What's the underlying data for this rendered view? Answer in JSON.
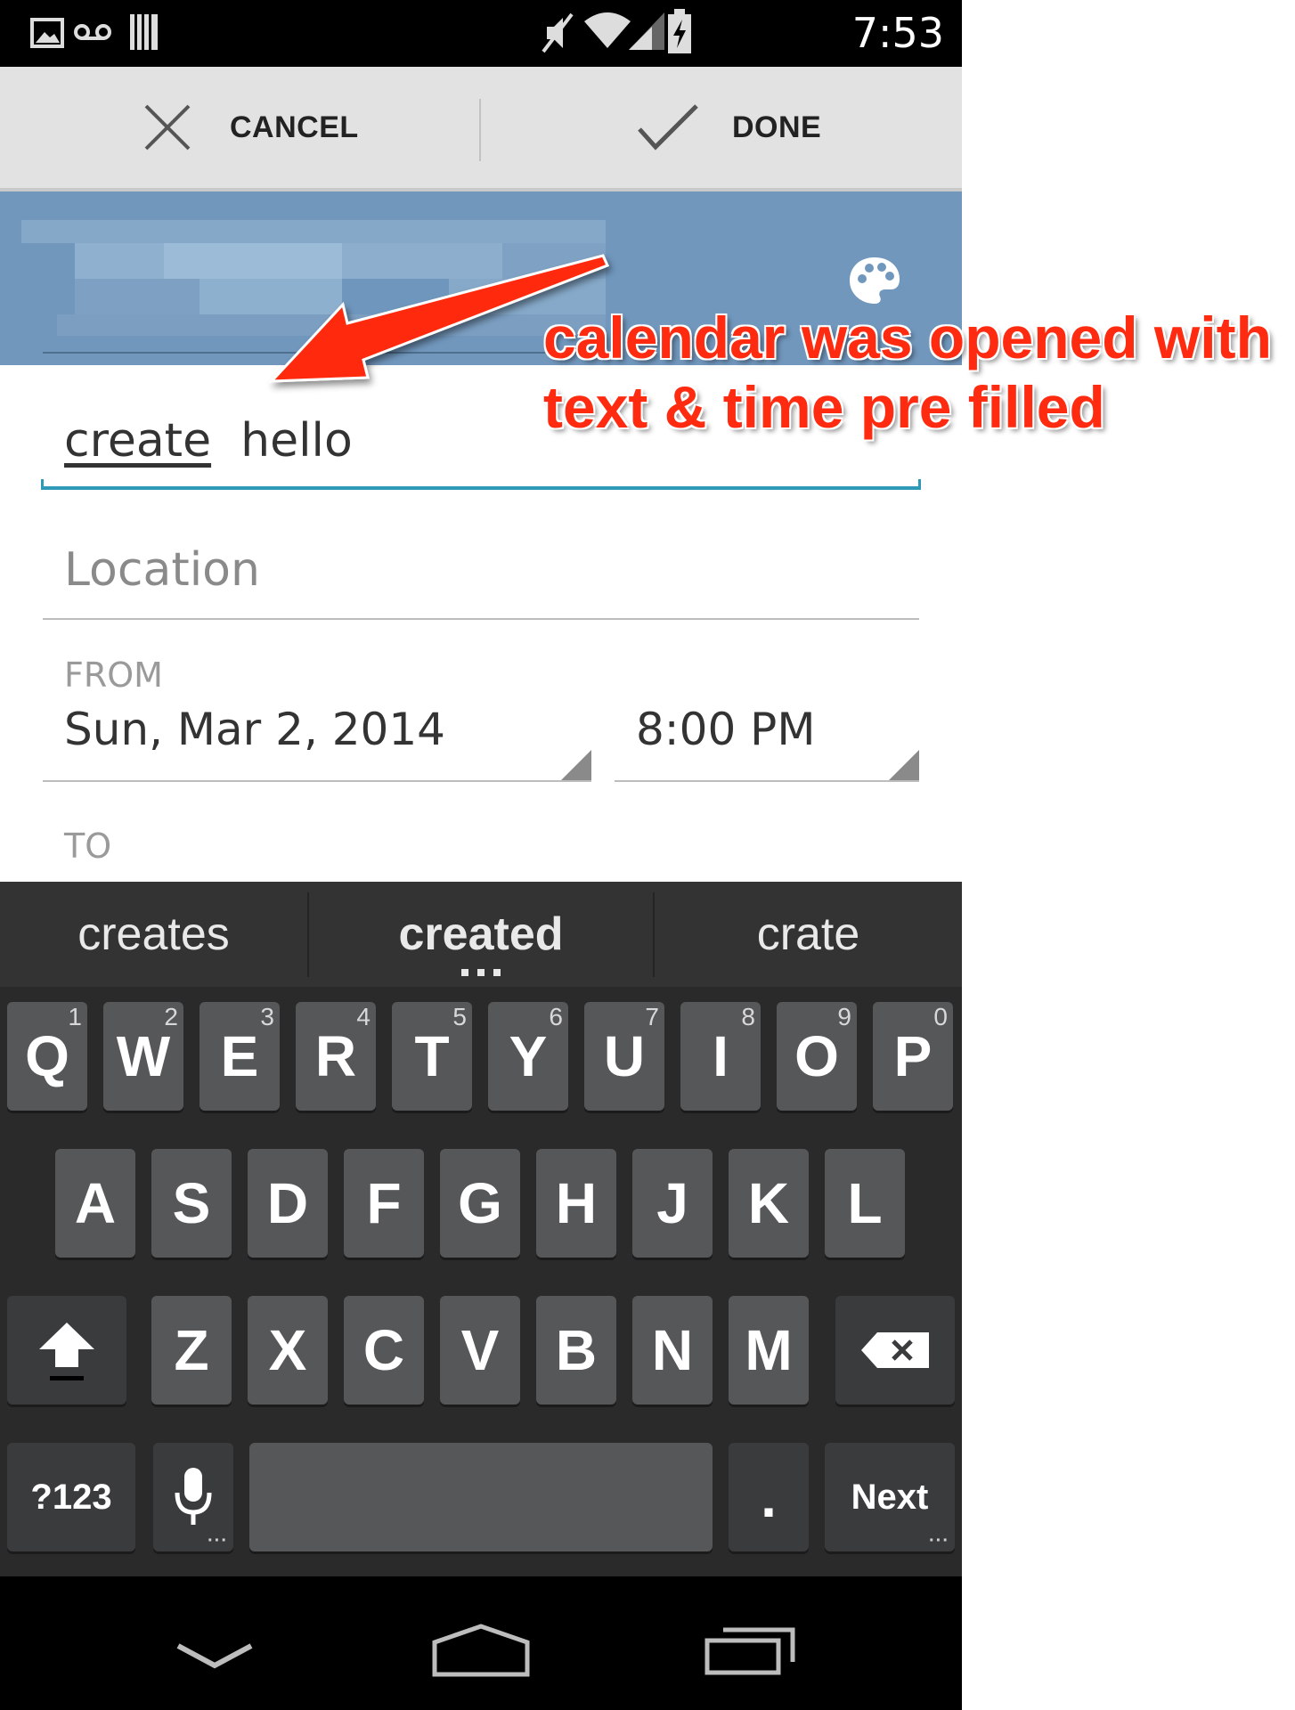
{
  "status_bar": {
    "time": "7:53",
    "icons": [
      "image-icon",
      "voicemail-icon",
      "barcode-icon",
      "muted-icon",
      "wifi-icon",
      "signal-icon",
      "battery-charging-icon"
    ]
  },
  "action_bar": {
    "cancel_label": "CANCEL",
    "done_label": "DONE"
  },
  "header": {
    "icon": "palette-icon"
  },
  "form": {
    "title_value": "create  hello",
    "title_word_underlined": "create",
    "title_rest": "hello",
    "location_placeholder": "Location",
    "from_label": "FROM",
    "from_date": "Sun, Mar 2, 2014",
    "from_time": "8:00 PM",
    "to_label": "TO"
  },
  "keyboard": {
    "suggestions": [
      "creates",
      "created",
      "crate"
    ],
    "row1": [
      {
        "key": "Q",
        "num": "1"
      },
      {
        "key": "W",
        "num": "2"
      },
      {
        "key": "E",
        "num": "3"
      },
      {
        "key": "R",
        "num": "4"
      },
      {
        "key": "T",
        "num": "5"
      },
      {
        "key": "Y",
        "num": "6"
      },
      {
        "key": "U",
        "num": "7"
      },
      {
        "key": "I",
        "num": "8"
      },
      {
        "key": "O",
        "num": "9"
      },
      {
        "key": "P",
        "num": "0"
      }
    ],
    "row2": [
      "A",
      "S",
      "D",
      "F",
      "G",
      "H",
      "J",
      "K",
      "L"
    ],
    "row3": [
      "Z",
      "X",
      "C",
      "V",
      "B",
      "N",
      "M"
    ],
    "symbols_label": "?123",
    "period_label": ".",
    "next_label": "Next"
  },
  "annotation": {
    "text_line1": "calendar was opened with",
    "text_line2": "text & time pre filled",
    "color": "#ff2b10"
  }
}
